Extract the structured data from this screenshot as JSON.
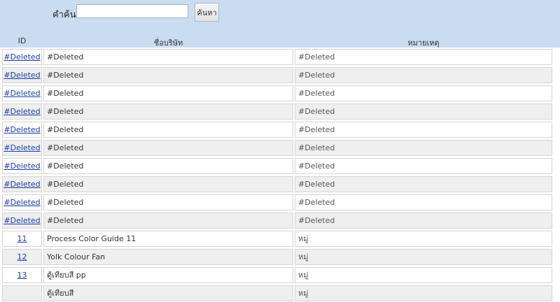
{
  "search": {
    "label": "คำค้น",
    "value": "",
    "placeholder": "",
    "button_label": "ค้นหา"
  },
  "table": {
    "columns": [
      "ID",
      "ชื่อบริษัท",
      "หมายเหตุ"
    ],
    "rows": [
      {
        "id": "#Deleted",
        "name": "#Deleted",
        "note": "#Deleted"
      },
      {
        "id": "#Deleted",
        "name": "#Deleted",
        "note": "#Deleted"
      },
      {
        "id": "#Deleted",
        "name": "#Deleted",
        "note": "#Deleted"
      },
      {
        "id": "#Deleted",
        "name": "#Deleted",
        "note": "#Deleted"
      },
      {
        "id": "#Deleted",
        "name": "#Deleted",
        "note": "#Deleted"
      },
      {
        "id": "#Deleted",
        "name": "#Deleted",
        "note": "#Deleted"
      },
      {
        "id": "#Deleted",
        "name": "#Deleted",
        "note": "#Deleted"
      },
      {
        "id": "#Deleted",
        "name": "#Deleted",
        "note": "#Deleted"
      },
      {
        "id": "#Deleted",
        "name": "#Deleted",
        "note": "#Deleted"
      },
      {
        "id": "#Deleted",
        "name": "#Deleted",
        "note": "#Deleted"
      },
      {
        "id": "11",
        "name": "Process Color Guide 11",
        "note": "หมู่"
      },
      {
        "id": "12",
        "name": "Yolk Colour Fan",
        "note": "หมู่"
      },
      {
        "id": "13",
        "name": "ตู้เทียบสี pp",
        "note": "หมู่"
      },
      {
        "id": "",
        "name": "ตู้เทียบสี",
        "note": "หมู่"
      }
    ]
  },
  "colors": {
    "header_bg": "#c9dcf1",
    "link": "#1a3da8",
    "alt_row": "#efefef"
  }
}
